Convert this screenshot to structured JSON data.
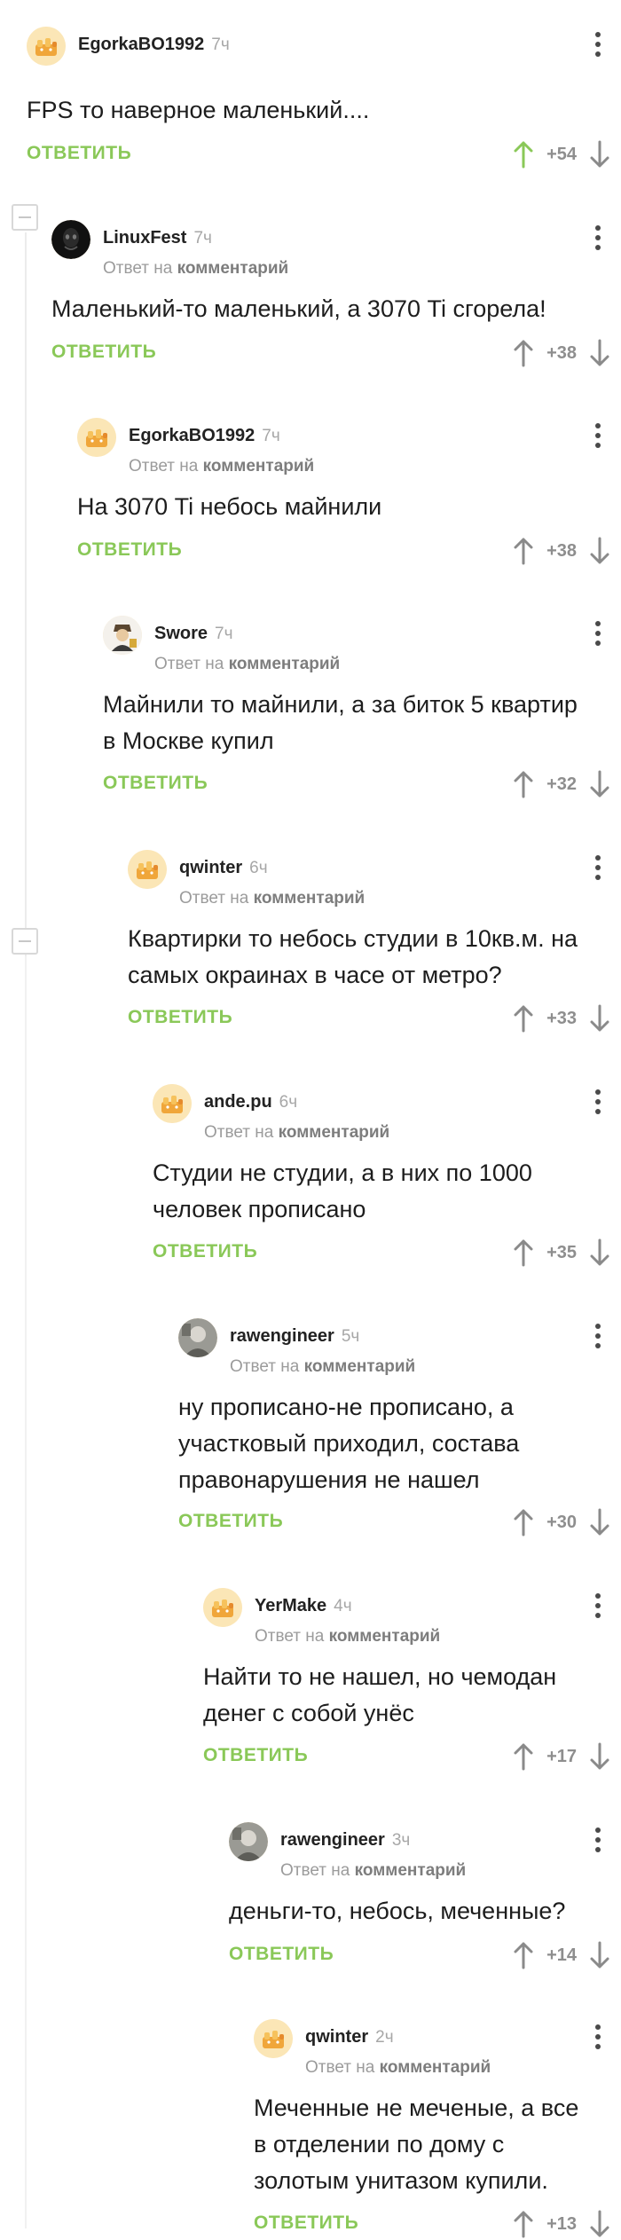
{
  "labels": {
    "reply": "ОТВЕТИТЬ",
    "reply_to_prefix": "Ответ на",
    "reply_to_link": "комментарий"
  },
  "comments": [
    {
      "author": "EgorkaBO1992",
      "time": "7ч",
      "text": "FPS то наверное маленький....",
      "score": "+54",
      "upvoted": true,
      "avatar": "pikabu-default-avatar",
      "is_reply": false
    },
    {
      "author": "LinuxFest",
      "time": "7ч",
      "text": "Маленький-то маленький, а 3070 Ti сгорела!",
      "score": "+38",
      "upvoted": false,
      "avatar": "dark-mask-avatar",
      "is_reply": true
    },
    {
      "author": "EgorkaBO1992",
      "time": "7ч",
      "text": "На 3070 Ti небось майнили",
      "score": "+38",
      "upvoted": false,
      "avatar": "pikabu-default-avatar",
      "is_reply": true
    },
    {
      "author": "Swore",
      "time": "7ч",
      "text": "Майнили то майнили, а за биток 5 квартир в Москве купил",
      "score": "+32",
      "upvoted": false,
      "avatar": "character-avatar",
      "is_reply": true
    },
    {
      "author": "qwinter",
      "time": "6ч",
      "text": "Квартирки то небось студии в 10кв.м. на самых окраинах в часе от метро?",
      "score": "+33",
      "upvoted": false,
      "avatar": "pikabu-default-avatar",
      "is_reply": true
    },
    {
      "author": "ande.pu",
      "time": "6ч",
      "text": "Студии не студии, а в них по 1000 человек прописано",
      "score": "+35",
      "upvoted": false,
      "avatar": "pikabu-default-avatar",
      "is_reply": true
    },
    {
      "author": "rawengineer",
      "time": "5ч",
      "text": "ну прописано-не прописано, а участковый приходил, состава правонарушения не нашел",
      "score": "+30",
      "upvoted": false,
      "avatar": "photo-avatar",
      "is_reply": true
    },
    {
      "author": "YerMake",
      "time": "4ч",
      "text": "Найти то не нашел, но чемодан денег с собой унёс",
      "score": "+17",
      "upvoted": false,
      "avatar": "pikabu-default-avatar",
      "is_reply": true
    },
    {
      "author": "rawengineer",
      "time": "3ч",
      "text": "деньги-то, небось, меченные?",
      "score": "+14",
      "upvoted": false,
      "avatar": "photo-avatar",
      "is_reply": true
    },
    {
      "author": "qwinter",
      "time": "2ч",
      "text": "Меченные не меченые, а все в отделении по дому с золотым унитазом купили.",
      "score": "+13",
      "upvoted": false,
      "avatar": "pikabu-default-avatar",
      "is_reply": true
    }
  ],
  "colors": {
    "accent_green": "#8ac858",
    "upvote_active": "#8ac858",
    "muted": "#9b9b9b",
    "thread_line": "#ececec"
  },
  "icons": {
    "upvote": "arrow-up-icon",
    "downvote": "arrow-down-icon",
    "menu": "more-vertical-icon",
    "collapse": "minus-square-icon"
  }
}
